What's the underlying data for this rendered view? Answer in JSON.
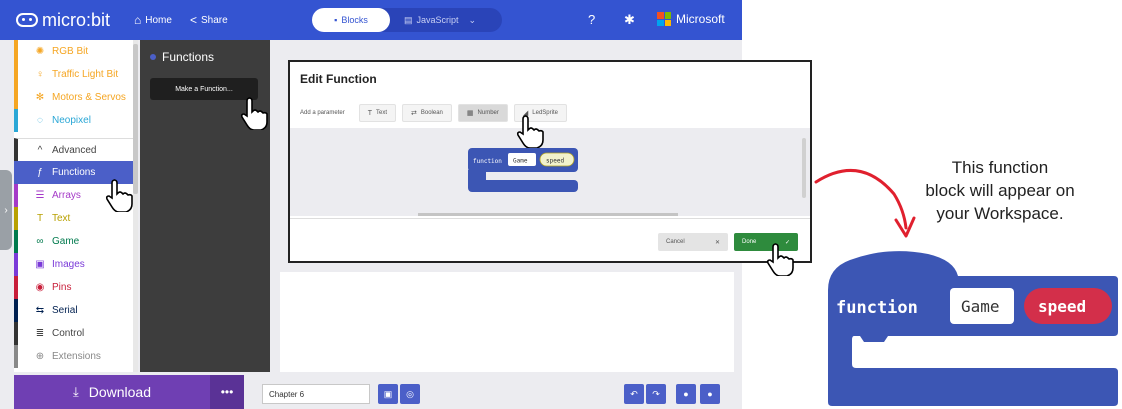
{
  "app": {
    "brand": "micro:bit",
    "home_label": "Home",
    "share_label": "Share",
    "mode_blocks": "Blocks",
    "mode_javascript": "JavaScript",
    "microsoft_label": "Microsoft"
  },
  "sidebar": {
    "items": [
      {
        "label": "RGB Bit",
        "color": "#f5a623",
        "icon": "sun-icon"
      },
      {
        "label": "Traffic Light Bit",
        "color": "#f5a623",
        "icon": "lightbulb-icon"
      },
      {
        "label": "Motors & Servos",
        "color": "#f5a623",
        "icon": "gears-icon"
      },
      {
        "label": "Neopixel",
        "color": "#2aa7d6",
        "icon": "ring-icon"
      },
      {
        "label": "Advanced",
        "color": "#333333",
        "icon": "chevron-up-icon"
      },
      {
        "label": "Functions",
        "color": "#4b5fc8",
        "icon": "function-icon"
      },
      {
        "label": "Arrays",
        "color": "#a53ac8",
        "icon": "list-icon"
      },
      {
        "label": "Text",
        "color": "#b8a000",
        "icon": "text-icon"
      },
      {
        "label": "Game",
        "color": "#007a4d",
        "icon": "gamepad-icon"
      },
      {
        "label": "Images",
        "color": "#7a3ad8",
        "icon": "image-icon"
      },
      {
        "label": "Pins",
        "color": "#c81e3a",
        "icon": "pin-icon"
      },
      {
        "label": "Serial",
        "color": "#002050",
        "icon": "usb-icon"
      },
      {
        "label": "Control",
        "color": "#333333",
        "icon": "control-icon"
      },
      {
        "label": "Extensions",
        "color": "#888888",
        "icon": "plus-circle-icon"
      }
    ]
  },
  "flyout": {
    "title": "Functions",
    "make_function_label": "Make a Function..."
  },
  "dialog": {
    "title": "Edit Function",
    "add_parameter_label": "Add a parameter",
    "param_buttons": [
      {
        "label": "Text",
        "icon": "text-icon"
      },
      {
        "label": "Boolean",
        "icon": "boolean-icon"
      },
      {
        "label": "Number",
        "icon": "number-icon"
      },
      {
        "label": "LedSprite",
        "icon": "sprite-icon"
      }
    ],
    "block": {
      "keyword": "function",
      "name": "Game",
      "param": "speed"
    },
    "cancel_label": "Cancel",
    "done_label": "Done"
  },
  "bottom": {
    "download_label": "Download",
    "more_label": "•••",
    "project_name": "Chapter 6"
  },
  "annotation": {
    "caption_line1": "This function",
    "caption_line2": "block will appear on",
    "caption_line3": "your Workspace.",
    "big_block": {
      "keyword": "function",
      "name": "Game",
      "param": "speed"
    }
  },
  "colors": {
    "topbar": "#3454d1",
    "function_block": "#3c56b4",
    "param_red": "#d32f4a",
    "download_purple": "#6f3fb3",
    "done_green": "#2e8b3d",
    "arrow_red": "#e0202e"
  }
}
